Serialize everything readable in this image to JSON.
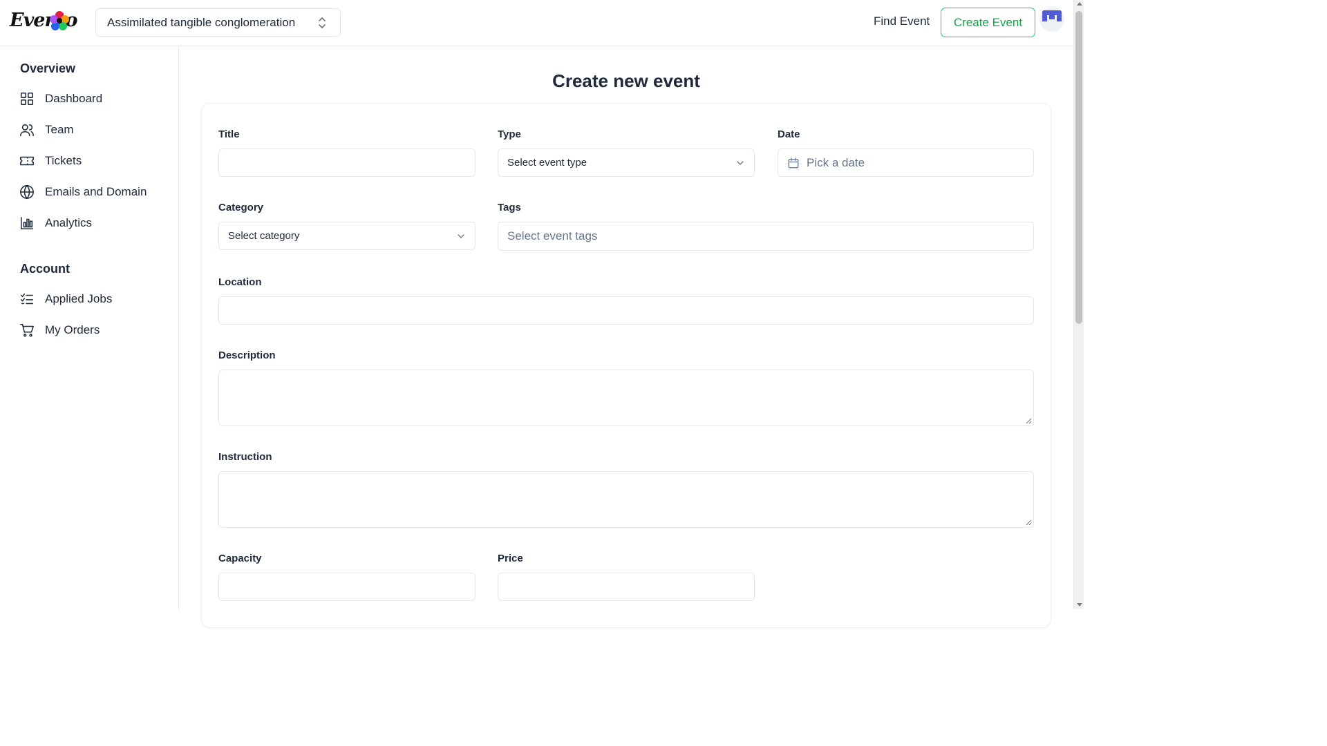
{
  "app": {
    "logo_text": "Evento",
    "org_switcher": "Assimilated tangible conglomeration",
    "find_event": "Find Event",
    "create_event": "Create Event"
  },
  "sidebar": {
    "overview_title": "Overview",
    "overview_items": [
      {
        "label": "Dashboard",
        "icon": "grid-icon"
      },
      {
        "label": "Team",
        "icon": "users-icon"
      },
      {
        "label": "Tickets",
        "icon": "ticket-icon"
      },
      {
        "label": "Emails and Domain",
        "icon": "globe-icon"
      },
      {
        "label": "Analytics",
        "icon": "bar-chart-icon"
      }
    ],
    "account_title": "Account",
    "account_items": [
      {
        "label": "Applied Jobs",
        "icon": "checklist-icon"
      },
      {
        "label": "My Orders",
        "icon": "cart-icon"
      }
    ]
  },
  "form": {
    "heading": "Create new event",
    "title": {
      "label": "Title",
      "value": ""
    },
    "type": {
      "label": "Type",
      "placeholder": "Select event type"
    },
    "date": {
      "label": "Date",
      "placeholder": "Pick a date"
    },
    "category": {
      "label": "Category",
      "placeholder": "Select category"
    },
    "tags": {
      "label": "Tags",
      "placeholder": "Select event tags"
    },
    "location": {
      "label": "Location",
      "value": ""
    },
    "description": {
      "label": "Description",
      "value": ""
    },
    "instruction": {
      "label": "Instruction",
      "value": ""
    },
    "capacity": {
      "label": "Capacity",
      "value": ""
    },
    "price": {
      "label": "Price",
      "value": ""
    }
  },
  "colors": {
    "accent_green": "#16a34a",
    "text_dark": "#1e293b",
    "border": "#e2e8f0",
    "avatar_blue": "#4f5bd5"
  }
}
